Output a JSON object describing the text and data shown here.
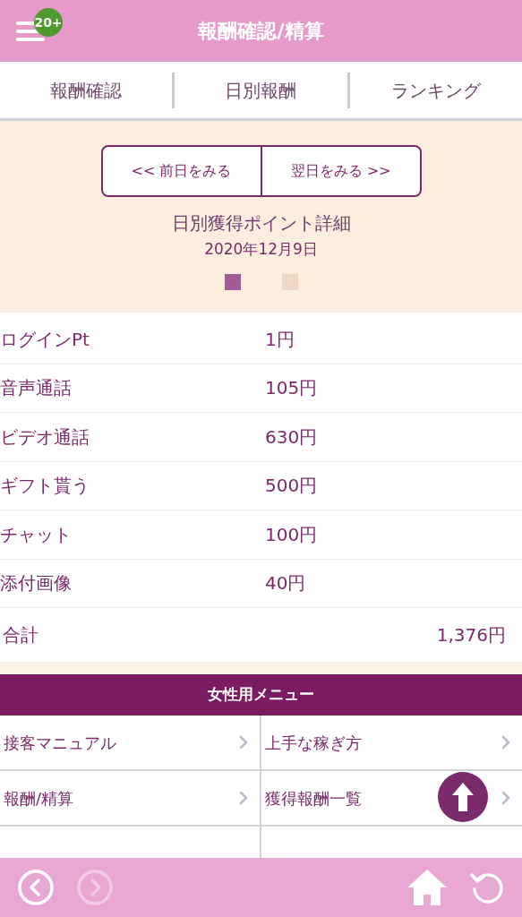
{
  "header": {
    "title": "報酬確認/精算",
    "badge": "20+"
  },
  "tabs": [
    {
      "label": "報酬確認"
    },
    {
      "label": "日別報酬"
    },
    {
      "label": "ランキング"
    }
  ],
  "day_nav": {
    "prev": "<< 前日をみる",
    "next": "翌日をみる >>"
  },
  "detail": {
    "title": "日別獲得ポイント詳細",
    "date": "2020年12月9日"
  },
  "pager": [
    {
      "selected": true
    },
    {
      "selected": false
    }
  ],
  "rows": [
    {
      "label": "ログインPt",
      "value": "1円"
    },
    {
      "label": "音声通話",
      "value": "105円"
    },
    {
      "label": "ビデオ通話",
      "value": "630円"
    },
    {
      "label": "ギフト貰う",
      "value": "500円"
    },
    {
      "label": "チャット",
      "value": "100円"
    },
    {
      "label": "添付画像",
      "value": "40円"
    }
  ],
  "total": {
    "label": "合計",
    "value": "1,376円"
  },
  "menu": {
    "title": "女性用メニュー",
    "items": [
      {
        "label": "接客マニュアル"
      },
      {
        "label": "上手な稼ぎ方"
      },
      {
        "label": "報酬/精算"
      },
      {
        "label": "獲得報酬一覧"
      }
    ]
  },
  "bottom_bar": {
    "back": {
      "disabled": false
    },
    "forward": {
      "disabled": true
    }
  }
}
